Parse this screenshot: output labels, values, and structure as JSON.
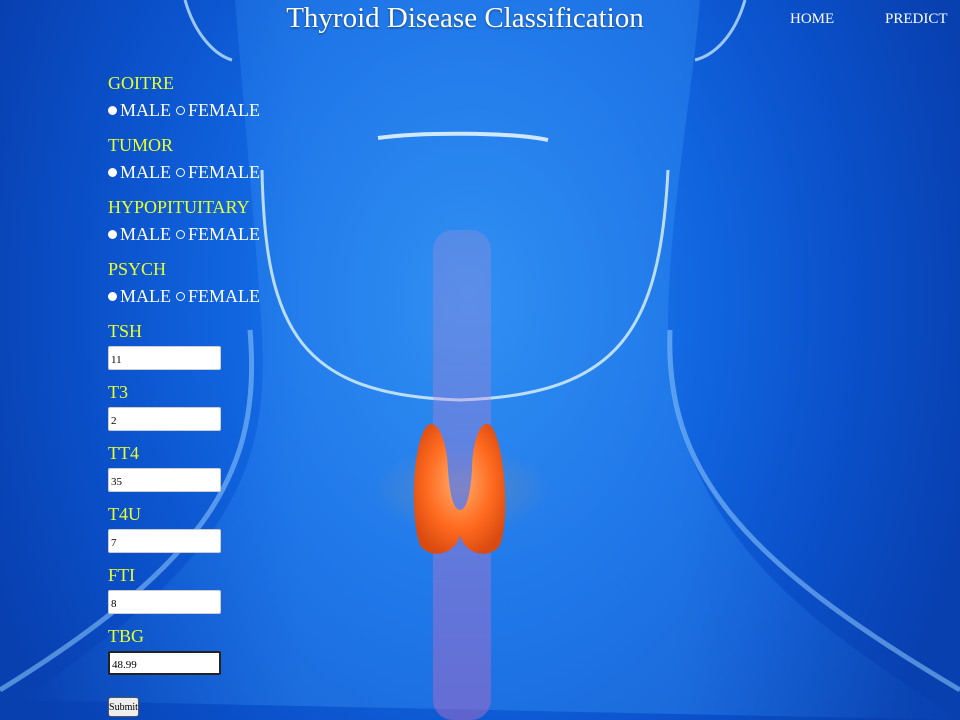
{
  "header": {
    "title": "Thyroid Disease Classification",
    "nav": {
      "home": "HOME",
      "predict": "PREDICT"
    }
  },
  "radio_options": {
    "male": "MALE",
    "female": "FEMALE"
  },
  "fields": {
    "goitre": {
      "label": "GOITRE",
      "selected": "MALE"
    },
    "tumor": {
      "label": "TUMOR",
      "selected": "MALE"
    },
    "hypopituitary": {
      "label": "HYPOPITUITARY",
      "selected": "MALE"
    },
    "psych": {
      "label": "PSYCH",
      "selected": "MALE"
    },
    "tsh": {
      "label": "TSH",
      "value": "11"
    },
    "t3": {
      "label": "T3",
      "value": "2"
    },
    "tt4": {
      "label": "TT4",
      "value": "35"
    },
    "t4u": {
      "label": "T4U",
      "value": "7"
    },
    "fti": {
      "label": "FTI",
      "value": "8"
    },
    "tbg": {
      "label": "TBG",
      "value": "48.99"
    }
  },
  "submit": {
    "label": "Submit"
  },
  "colors": {
    "background": "#1166e0",
    "label": "#e8ff2e",
    "thyroid": "#ff6a1f"
  }
}
